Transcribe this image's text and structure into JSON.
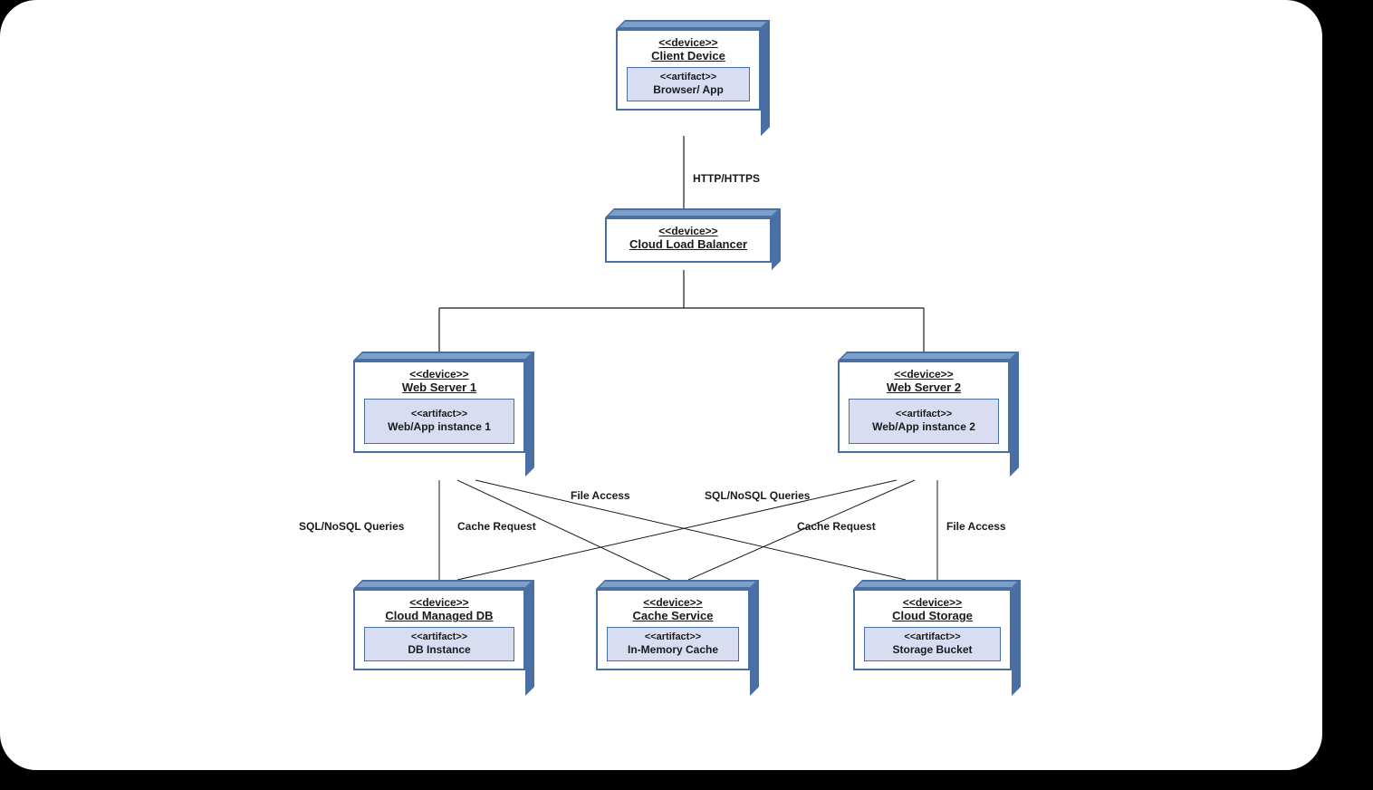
{
  "stereotypes": {
    "device": "<<device>>",
    "artifact": "<<artifact>>"
  },
  "nodes": {
    "client": {
      "name": "Client Device",
      "artifact": "Browser/ App"
    },
    "lb": {
      "name": "Cloud Load Balancer"
    },
    "ws1": {
      "name": "Web Server 1",
      "artifact": "Web/App instance 1"
    },
    "ws2": {
      "name": "Web Server 2",
      "artifact": "Web/App instance 2"
    },
    "db": {
      "name": "Cloud Managed DB",
      "artifact": "DB Instance"
    },
    "cache": {
      "name": "Cache Service",
      "artifact": "In-Memory Cache"
    },
    "storage": {
      "name": "Cloud Storage",
      "artifact": "Storage Bucket"
    }
  },
  "edges": {
    "http": "HTTP/HTTPS",
    "sql": "SQL/NoSQL Queries",
    "cache": "Cache Request",
    "file": "File Access"
  }
}
